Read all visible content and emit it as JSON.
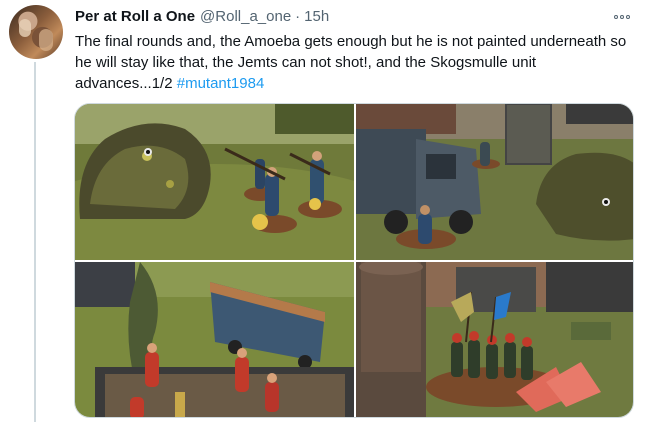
{
  "author": {
    "display_name": "Per at Roll a One",
    "handle": "@Roll_a_one",
    "separator": "·",
    "time": "15h"
  },
  "tweet": {
    "text": "The final rounds and, the Amoeba gets enough but he is not painted underneath so he will stay like that, the Jemts can not shot!, and the Skogsmulle unit advances...1/2 ",
    "hashtag": "#mutant1984"
  },
  "icons": {
    "more": "more-options-icon"
  },
  "colors": {
    "link": "#1d9bf0",
    "secondary_text": "#536471",
    "thread_line": "#cfd9de"
  }
}
